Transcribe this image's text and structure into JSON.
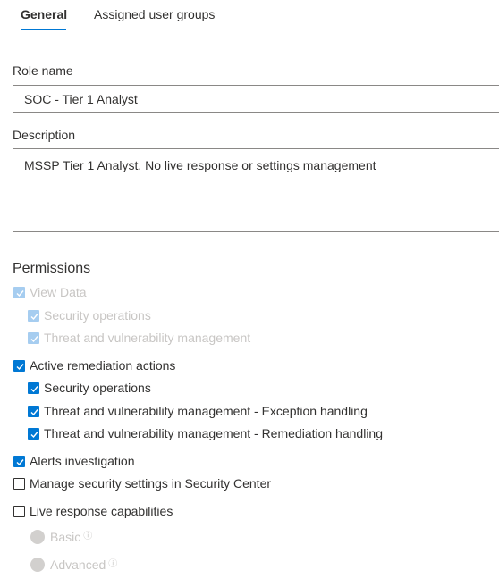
{
  "tabs": [
    {
      "label": "General"
    },
    {
      "label": "Assigned user groups"
    }
  ],
  "role_name": {
    "label": "Role name",
    "value": "SOC - Tier 1 Analyst"
  },
  "description": {
    "label": "Description",
    "value": "MSSP Tier 1 Analyst. No live response or settings management"
  },
  "permissions": {
    "title": "Permissions",
    "items": [
      {
        "label": "View Data",
        "checked": true,
        "disabled": true
      },
      {
        "label": "Security operations",
        "checked": true,
        "disabled": true
      },
      {
        "label": "Threat and vulnerability management",
        "checked": true,
        "disabled": true
      },
      {
        "label": "Active remediation actions",
        "checked": true,
        "disabled": false
      },
      {
        "label": "Security operations",
        "checked": true,
        "disabled": false
      },
      {
        "label": "Threat and vulnerability management - Exception handling",
        "checked": true,
        "disabled": false
      },
      {
        "label": "Threat and vulnerability management - Remediation handling",
        "checked": true,
        "disabled": false
      },
      {
        "label": "Alerts investigation",
        "checked": true,
        "disabled": false
      },
      {
        "label": "Manage security settings in Security Center",
        "checked": false,
        "disabled": false
      },
      {
        "label": "Live response capabilities",
        "checked": false,
        "disabled": false
      }
    ],
    "live_response_options": [
      {
        "label": "Basic",
        "info_icon": "info-icon"
      },
      {
        "label": "Advanced",
        "info_icon": "info-icon"
      }
    ]
  },
  "colors": {
    "accent": "#0078d4",
    "disabled_text": "#c8c6c4",
    "disabled_check": "#a6cdf0"
  }
}
